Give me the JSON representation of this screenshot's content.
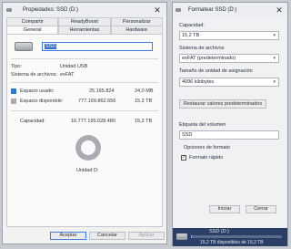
{
  "props": {
    "title": "Propiedades: SSD (D:)",
    "tabs_row1": [
      "Compartir",
      "ReadyBoost",
      "Personalizar"
    ],
    "tabs_row2": [
      "General",
      "Herramientas",
      "Hardware"
    ],
    "volume_name": "SSD",
    "type_label": "Tipo:",
    "type_value": "Unidad USB",
    "fs_label": "Sistema de archivos:",
    "fs_value": "exFAT",
    "used_label": "Espacio usado:",
    "used_bytes": "25.165.824",
    "used_human": "24,0 MB",
    "free_label": "Espacio disponible:",
    "free_bytes": "777.169.862.656",
    "free_human": "15,2 TB",
    "cap_label": "Capacidad:",
    "cap_bytes": "16.777.195.028.480",
    "cap_human": "15,2 TB",
    "drive_label": "Unidad D:",
    "btn_ok": "Aceptar",
    "btn_cancel": "Cancelar",
    "btn_apply": "Aplicar",
    "colors": {
      "used": "#2a79d6",
      "free": "#a9adb3"
    }
  },
  "format": {
    "title": "Formatear SSD (D:)",
    "capacity_label": "Capacidad:",
    "capacity_value": "15,2 TB",
    "fs_label": "Sistema de archivos",
    "fs_value": "exFAT (predeterminado)",
    "alloc_label": "Tamaño de unidad de asignación",
    "alloc_value": "4096 kilobytes",
    "restore_button": "Restaurar valores predeterminados",
    "volume_label": "Etiqueta del volumen",
    "volume_value": "SSD",
    "options_label": "Opciones de formato",
    "quick_label": "Formato rápido",
    "start_button": "Iniciar",
    "close_button": "Cerrar"
  },
  "taskbar": {
    "name": "SSD (D:)",
    "detail": "15,2 TB disponibles de 15,2 TB"
  }
}
